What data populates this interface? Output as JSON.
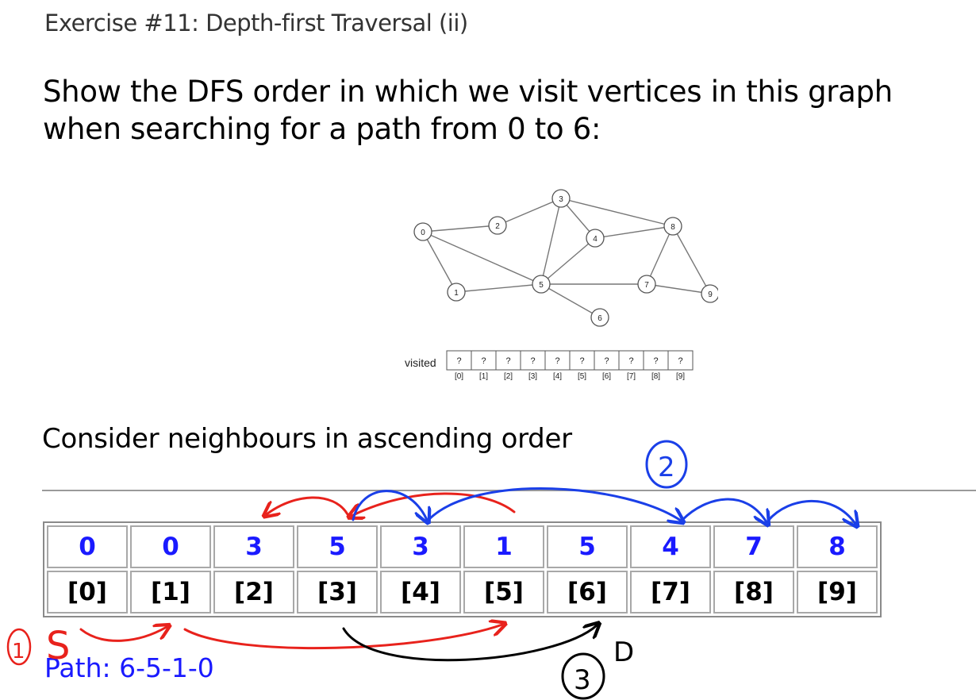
{
  "slide": {
    "subtitle": "Exercise #11: Depth-first Traversal (ii)",
    "question": "Show the DFS order in which we visit vertices in this graph when searching for a path from 0 to 6:",
    "hint": "Consider neighbours in ascending order",
    "path_text": "Path: 6-5-1-0"
  },
  "graph": {
    "nodes": [
      {
        "id": "0",
        "label": "0"
      },
      {
        "id": "1",
        "label": "1"
      },
      {
        "id": "2",
        "label": "2"
      },
      {
        "id": "3",
        "label": "3"
      },
      {
        "id": "4",
        "label": "4"
      },
      {
        "id": "5",
        "label": "5"
      },
      {
        "id": "6",
        "label": "6"
      },
      {
        "id": "7",
        "label": "7"
      },
      {
        "id": "8",
        "label": "8"
      },
      {
        "id": "9",
        "label": "9"
      }
    ],
    "edges": [
      [
        "0",
        "1"
      ],
      [
        "0",
        "2"
      ],
      [
        "0",
        "5"
      ],
      [
        "1",
        "5"
      ],
      [
        "2",
        "3"
      ],
      [
        "3",
        "4"
      ],
      [
        "3",
        "5"
      ],
      [
        "3",
        "8"
      ],
      [
        "4",
        "5"
      ],
      [
        "4",
        "8"
      ],
      [
        "5",
        "6"
      ],
      [
        "5",
        "7"
      ],
      [
        "7",
        "8"
      ],
      [
        "7",
        "9"
      ],
      [
        "8",
        "9"
      ]
    ],
    "array_label": "visited",
    "array_cells": [
      "?",
      "?",
      "?",
      "?",
      "?",
      "?",
      "?",
      "?",
      "?",
      "?"
    ],
    "array_indices": [
      "[0]",
      "[1]",
      "[2]",
      "[3]",
      "[4]",
      "[5]",
      "[6]",
      "[7]",
      "[8]",
      "[9]"
    ]
  },
  "visited_table": {
    "values": [
      "0",
      "0",
      "3",
      "5",
      "3",
      "1",
      "5",
      "4",
      "7",
      "8"
    ],
    "indices": [
      "[0]",
      "[1]",
      "[2]",
      "[3]",
      "[4]",
      "[5]",
      "[6]",
      "[7]",
      "[8]",
      "[9]"
    ]
  },
  "annotations": {
    "step1": "1",
    "start_mark": "S",
    "step2": "2",
    "step3": "3",
    "dest_mark": "D",
    "colors": {
      "red": "#e8221c",
      "blue": "#1a3fe8",
      "black": "#000000"
    }
  }
}
